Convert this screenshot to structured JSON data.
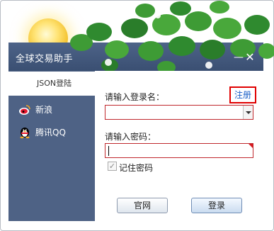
{
  "app": {
    "title": "全球交易助手"
  },
  "window_controls": {
    "minimize": "—",
    "close": "✕"
  },
  "sidebar": {
    "items": [
      {
        "label": "JSON登陆",
        "active": true
      },
      {
        "label": "新浪",
        "icon": "sina-weibo-icon"
      },
      {
        "label": "腾讯QQ",
        "icon": "qq-penguin-icon"
      }
    ]
  },
  "login_form": {
    "username_label": "请输入登录名：",
    "register_link": "注册",
    "username_value": "",
    "password_label": "请输入密码：",
    "password_value": "",
    "remember_label": "记住密码",
    "remember_checked": true,
    "remember_check_glyph": "✓",
    "official_site_button": "官网",
    "login_button": "登录"
  },
  "colors": {
    "titlebar": "#4d6388",
    "sidebar": "#4e6285",
    "field_border": "#c0282d",
    "register_link": "#1a5fc7",
    "register_highlight": "#e00000"
  }
}
